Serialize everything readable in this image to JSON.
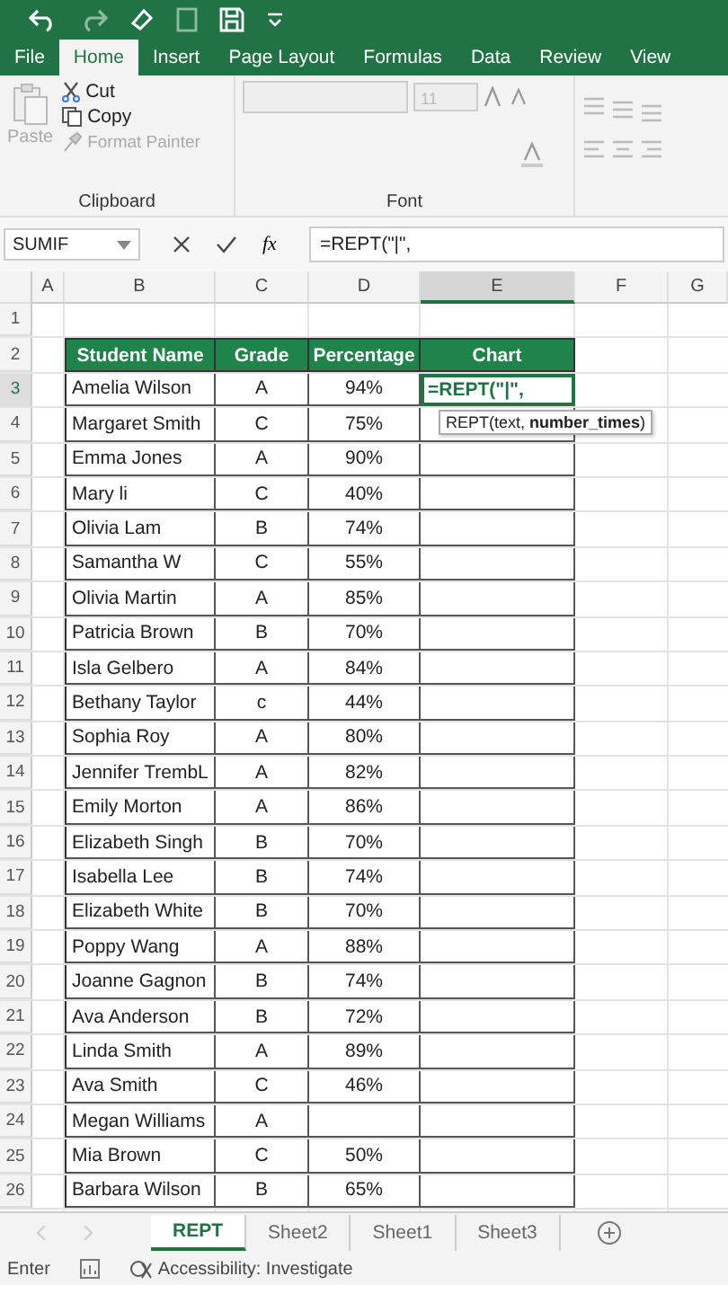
{
  "ribbon_tabs": [
    {
      "label": "File",
      "selected": false
    },
    {
      "label": "Home",
      "selected": true
    },
    {
      "label": "Insert",
      "selected": false
    },
    {
      "label": "Page Layout",
      "selected": false
    },
    {
      "label": "Formulas",
      "selected": false
    },
    {
      "label": "Data",
      "selected": false
    },
    {
      "label": "Review",
      "selected": false
    },
    {
      "label": "View",
      "selected": false
    }
  ],
  "clipboard": {
    "paste": "Paste",
    "cut": "Cut",
    "copy": "Copy",
    "format_painter": "Format Painter",
    "group_label": "Clipboard"
  },
  "font": {
    "font_size": "11",
    "group_label": "Font"
  },
  "formula_bar": {
    "name_box": "SUMIF",
    "fx": "fx",
    "formula": "=REPT(\"|\","
  },
  "columns": [
    "A",
    "B",
    "C",
    "D",
    "E",
    "F",
    "G"
  ],
  "row_numbers": [
    "1",
    "2",
    "3",
    "4",
    "5",
    "6",
    "7",
    "8",
    "9",
    "10",
    "11",
    "12",
    "13",
    "14",
    "15",
    "16",
    "17",
    "18",
    "19",
    "20",
    "21",
    "22",
    "23",
    "24",
    "25",
    "26"
  ],
  "table": {
    "headers": [
      "Student Name",
      "Grade",
      "Percentage",
      "Chart"
    ],
    "rows": [
      {
        "name": "Amelia Wilson",
        "grade": "A",
        "percentage": "94%",
        "chart": "=REPT(\"|\",",
        "editing": true
      },
      {
        "name": "Margaret Smith",
        "grade": "C",
        "percentage": "75%"
      },
      {
        "name": "Emma Jones",
        "grade": "A",
        "percentage": "90%"
      },
      {
        "name": "Mary li",
        "grade": "C",
        "percentage": "40%"
      },
      {
        "name": "Olivia Lam",
        "grade": "B",
        "percentage": "74%"
      },
      {
        "name": "Samantha W",
        "grade": "C",
        "percentage": "55%"
      },
      {
        "name": "Olivia Martin",
        "grade": "A",
        "percentage": "85%"
      },
      {
        "name": "Patricia Brown",
        "grade": "B",
        "percentage": "70%"
      },
      {
        "name": "Isla Gelbero",
        "grade": "A",
        "percentage": "84%"
      },
      {
        "name": "Bethany Taylor",
        "grade": "c",
        "percentage": "44%"
      },
      {
        "name": "Sophia Roy",
        "grade": "A",
        "percentage": "80%"
      },
      {
        "name": "Jennifer TrembL",
        "grade": "A",
        "percentage": "82%"
      },
      {
        "name": "Emily Morton",
        "grade": "A",
        "percentage": "86%"
      },
      {
        "name": "Elizabeth Singh",
        "grade": "B",
        "percentage": "70%"
      },
      {
        "name": "Isabella Lee",
        "grade": "B",
        "percentage": "74%"
      },
      {
        "name": "Elizabeth White",
        "grade": "B",
        "percentage": "70%"
      },
      {
        "name": "Poppy Wang",
        "grade": "A",
        "percentage": "88%"
      },
      {
        "name": "Joanne Gagnon",
        "grade": "B",
        "percentage": "74%"
      },
      {
        "name": "Ava Anderson",
        "grade": "B",
        "percentage": "72%"
      },
      {
        "name": "Linda Smith",
        "grade": "A",
        "percentage": "89%"
      },
      {
        "name": "Ava Smith",
        "grade": "C",
        "percentage": "46%"
      },
      {
        "name": "Megan Williams",
        "grade": "A"
      },
      {
        "name": "Mia Brown",
        "grade": "C",
        "percentage": "50%"
      },
      {
        "name": "Barbara Wilson",
        "grade": "B",
        "percentage": "65%"
      }
    ]
  },
  "tooltip": "REPT(text, **number_times**)",
  "sheet_tabs": [
    {
      "label": "REPT",
      "selected": true
    },
    {
      "label": "Sheet2",
      "selected": false
    },
    {
      "label": "Sheet1",
      "selected": false
    },
    {
      "label": "Sheet3",
      "selected": false
    }
  ],
  "status_bar": {
    "mode": "Enter",
    "accessibility": "Accessibility: Investigate"
  }
}
